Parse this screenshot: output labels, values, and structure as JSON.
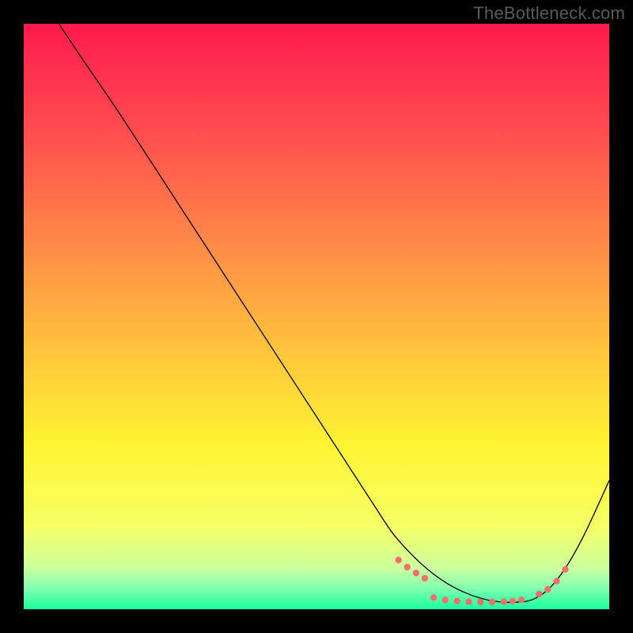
{
  "watermark": "TheBottleneck.com",
  "chart_data": {
    "type": "line",
    "title": "",
    "xlabel": "",
    "ylabel": "",
    "xlim": [
      0,
      100
    ],
    "ylim": [
      0,
      100
    ],
    "grid": false,
    "legend": false,
    "series": [
      {
        "name": "curve",
        "stroke": "#000000",
        "stroke_width": 1.3,
        "x": [
          6,
          10,
          15,
          20,
          25,
          30,
          35,
          40,
          45,
          50,
          55,
          60,
          63,
          66,
          69,
          72,
          75,
          78,
          81,
          84,
          87,
          90,
          93,
          96,
          100
        ],
        "y": [
          100,
          94,
          86.7,
          79.1,
          71.4,
          63.7,
          56.0,
          48.3,
          40.6,
          32.9,
          25.2,
          17.5,
          13.0,
          9.6,
          6.8,
          4.6,
          3.0,
          1.9,
          1.3,
          1.2,
          1.7,
          3.8,
          7.8,
          13.3,
          22.0
        ]
      }
    ],
    "markers": {
      "name": "highlight-dots",
      "color": "#ef6f6d",
      "radius": 4.2,
      "clusters": [
        {
          "x_range": [
            64,
            69
          ],
          "y_approx": 6.5,
          "count": 4
        },
        {
          "x_range": [
            69,
            85
          ],
          "y_approx": 1.4,
          "count": 10
        },
        {
          "x_range": [
            88,
            92
          ],
          "y_approx": 4.0,
          "count": 4
        }
      ],
      "points": [
        {
          "x": 64.0,
          "y": 8.4
        },
        {
          "x": 65.5,
          "y": 7.2
        },
        {
          "x": 67.0,
          "y": 6.2
        },
        {
          "x": 68.5,
          "y": 5.3
        },
        {
          "x": 70.0,
          "y": 2.0
        },
        {
          "x": 72.0,
          "y": 1.6
        },
        {
          "x": 74.0,
          "y": 1.4
        },
        {
          "x": 76.0,
          "y": 1.3
        },
        {
          "x": 78.0,
          "y": 1.25
        },
        {
          "x": 80.0,
          "y": 1.25
        },
        {
          "x": 82.0,
          "y": 1.3
        },
        {
          "x": 83.5,
          "y": 1.4
        },
        {
          "x": 85.0,
          "y": 1.6
        },
        {
          "x": 88.0,
          "y": 2.6
        },
        {
          "x": 89.5,
          "y": 3.4
        },
        {
          "x": 91.0,
          "y": 4.8
        },
        {
          "x": 92.5,
          "y": 6.8
        }
      ]
    },
    "background_gradient": {
      "stops": [
        {
          "offset": 0.0,
          "color": "#ff1a4d"
        },
        {
          "offset": 0.18,
          "color": "#ff4b4f"
        },
        {
          "offset": 0.38,
          "color": "#ff8b47"
        },
        {
          "offset": 0.55,
          "color": "#ffc23c"
        },
        {
          "offset": 0.72,
          "color": "#fff433"
        },
        {
          "offset": 0.86,
          "color": "#f6ff66"
        },
        {
          "offset": 0.93,
          "color": "#ccffa0"
        },
        {
          "offset": 0.965,
          "color": "#7fffb0"
        },
        {
          "offset": 1.0,
          "color": "#1aff9e"
        }
      ]
    }
  }
}
